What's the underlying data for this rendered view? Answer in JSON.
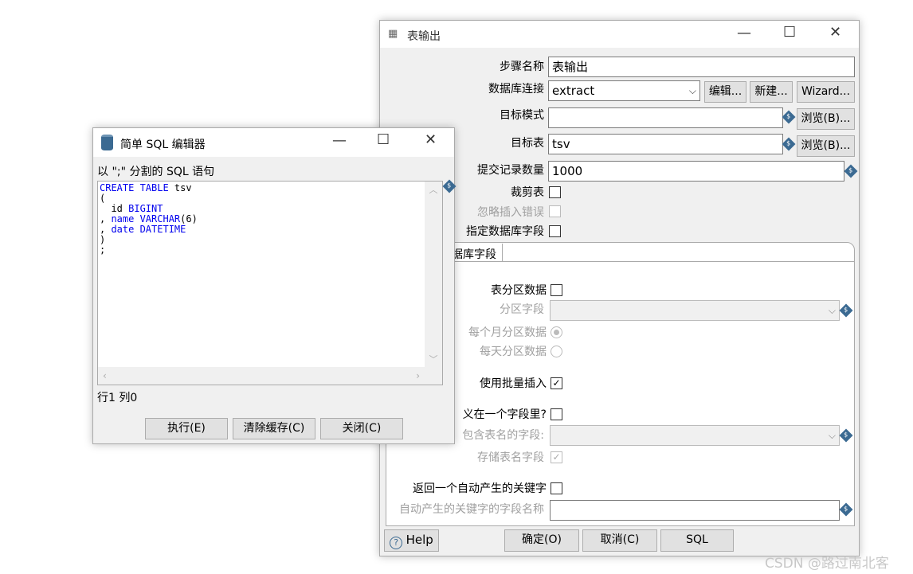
{
  "main": {
    "title": "表输出",
    "icon": "table-icon",
    "fields": {
      "step_name_label": "步骤名称",
      "step_name": "表输出",
      "db_conn_label": "数据库连接",
      "db_conn": "extract",
      "edit": "编辑...",
      "new": "新建...",
      "wizard": "Wizard...",
      "schema_label": "目标模式",
      "schema": "",
      "browse": "浏览(B)...",
      "table_label": "目标表",
      "table": "tsv",
      "commit_label": "提交记录数量",
      "commit": "1000",
      "truncate_label": "裁剪表",
      "ignore_label": "忽略插入错误",
      "specify_label": "指定数据库字段"
    },
    "tab": "据库字段",
    "partition_label": "表分区数据",
    "partition_field_label": "分区字段",
    "monthly_label": "每个月分区数据",
    "daily_label": "每天分区数据",
    "batch_label": "使用批量插入",
    "name_in_field_label": "义在一个字段里?",
    "name_field_label": "包含表名的字段:",
    "store_name_label": "存储表名字段",
    "return_key_label": "返回一个自动产生的关键字",
    "key_field_label": "自动产生的关键字的字段名称",
    "checks": {
      "truncate": false,
      "ignore": false,
      "specify": false,
      "partition": false,
      "batch": true,
      "name_in_field": false,
      "store_name": true,
      "return_key": false
    },
    "monthly_selected": true,
    "buttons": {
      "help": "Help",
      "ok": "确定(O)",
      "cancel": "取消(C)",
      "sql": "SQL"
    }
  },
  "sql": {
    "title": "简单 SQL 编辑器",
    "icon": "database-icon",
    "label": "以 \";\" 分割的 SQL 语句",
    "lines": [
      [
        [
          "CREATE TABLE",
          "kw"
        ],
        [
          " tsv",
          ""
        ]
      ],
      [
        [
          "(",
          ""
        ]
      ],
      [
        [
          "  id ",
          ""
        ],
        [
          "BIGINT",
          "kw"
        ]
      ],
      [
        [
          ", ",
          ""
        ],
        [
          "name VARCHAR",
          "kw"
        ],
        [
          "(6)",
          ""
        ]
      ],
      [
        [
          ", ",
          ""
        ],
        [
          "date DATETIME",
          "kw"
        ]
      ],
      [
        [
          ")",
          ""
        ]
      ],
      [
        [
          ";",
          ""
        ]
      ]
    ],
    "status": "行1 列0",
    "buttons": {
      "execute": "执行(E)",
      "clear": "清除缓存(C)",
      "close": "关闭(C)"
    }
  },
  "watermark": "CSDN @路过南北客"
}
